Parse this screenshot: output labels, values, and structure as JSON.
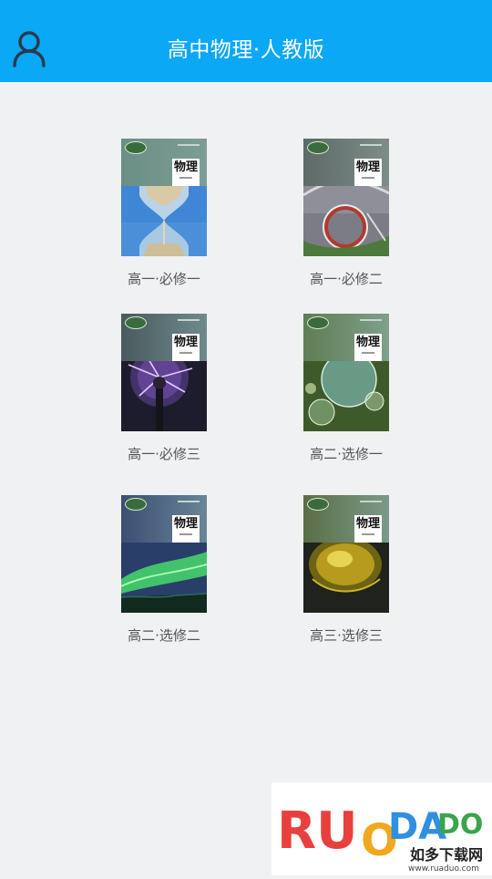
{
  "header": {
    "title": "高中物理·人教版",
    "user_icon": "user-icon"
  },
  "books": [
    {
      "name": "高一·必修一",
      "cover_title": "物理",
      "theme": "hourglass"
    },
    {
      "name": "高一·必修二",
      "cover_title": "物理",
      "theme": "rollercoaster"
    },
    {
      "name": "高一·必修三",
      "cover_title": "物理",
      "theme": "plasma-ball"
    },
    {
      "name": "高二·选修一",
      "cover_title": "物理",
      "theme": "bubbles"
    },
    {
      "name": "高二·选修二",
      "cover_title": "物理",
      "theme": "aurora"
    },
    {
      "name": "高三·选修三",
      "cover_title": "物理",
      "theme": "golden-disc"
    }
  ],
  "watermark": {
    "brand": "RUAODADO",
    "cn": "如多下载网",
    "url": "www.ruaduo.com"
  },
  "colors": {
    "header": "#0aa8f5",
    "background": "#f0f1f3"
  }
}
